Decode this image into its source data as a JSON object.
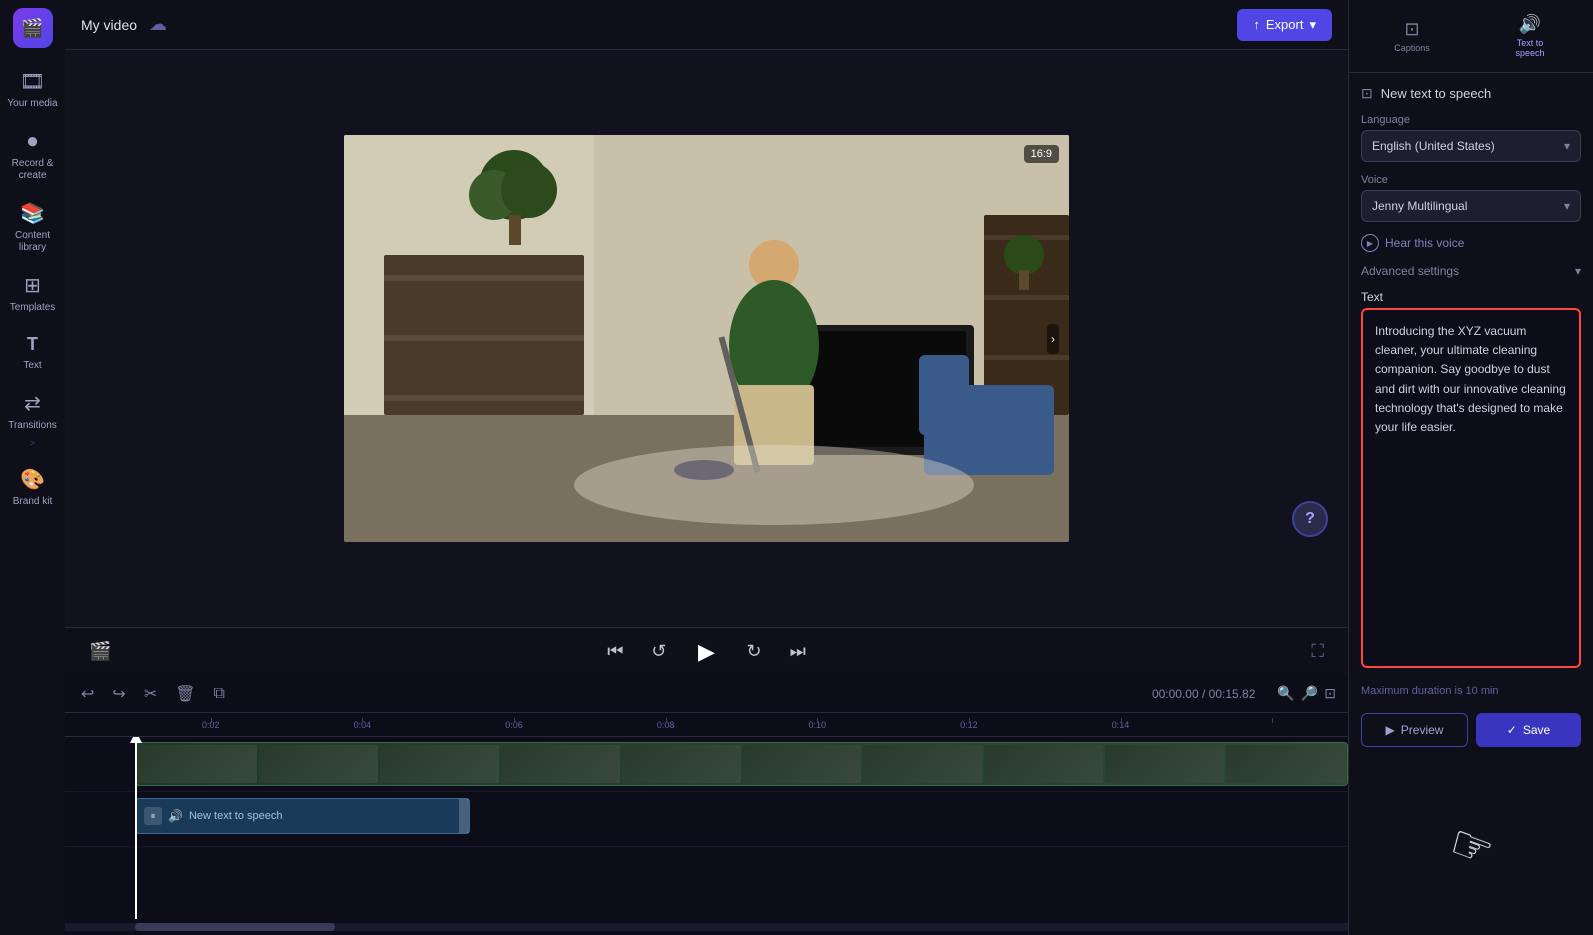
{
  "app": {
    "logo": "🎬",
    "title": "My video"
  },
  "sidebar": {
    "items": [
      {
        "id": "your-media",
        "icon": "🎞",
        "label": "Your media"
      },
      {
        "id": "record-create",
        "icon": "⏺",
        "label": "Record &\ncreate"
      },
      {
        "id": "content-library",
        "icon": "📚",
        "label": "Content\nlibrary"
      },
      {
        "id": "templates",
        "icon": "⊞",
        "label": "Templates"
      },
      {
        "id": "text",
        "icon": "T",
        "label": "Text"
      },
      {
        "id": "transitions",
        "icon": "⇄",
        "label": "Transitions"
      },
      {
        "id": "brand-kit",
        "icon": "🎨",
        "label": "Brand kit"
      }
    ]
  },
  "topbar": {
    "title": "My video",
    "export_label": "↑ Export"
  },
  "video": {
    "aspect_ratio": "16:9",
    "time_current": "00:00.00",
    "time_total": "00:15.82"
  },
  "timeline": {
    "time_display": "00:00.00 / 00:15.82",
    "ruler_marks": [
      "0:02",
      "0:04",
      "0:06",
      "0:08",
      "0:10",
      "0:12",
      "0:14",
      ""
    ],
    "audio_track_label": "New text to speech"
  },
  "right_panel": {
    "captions_label": "Captions",
    "tts_label": "Text to\nspeech",
    "panel_title": "New text to speech",
    "language_label": "Language",
    "language_value": "English (United States)",
    "voice_label": "Voice",
    "voice_value": "Jenny Multilingual",
    "hear_voice_label": "Hear this voice",
    "advanced_settings_label": "Advanced settings",
    "text_label": "Text",
    "text_content": "Introducing the XYZ vacuum cleaner, your ultimate cleaning companion. Say goodbye to dust and dirt with our innovative cleaning technology that's designed to make your life easier.",
    "max_duration_note": "Maximum duration is 10 min",
    "preview_label": "Preview",
    "save_label": "Save"
  }
}
